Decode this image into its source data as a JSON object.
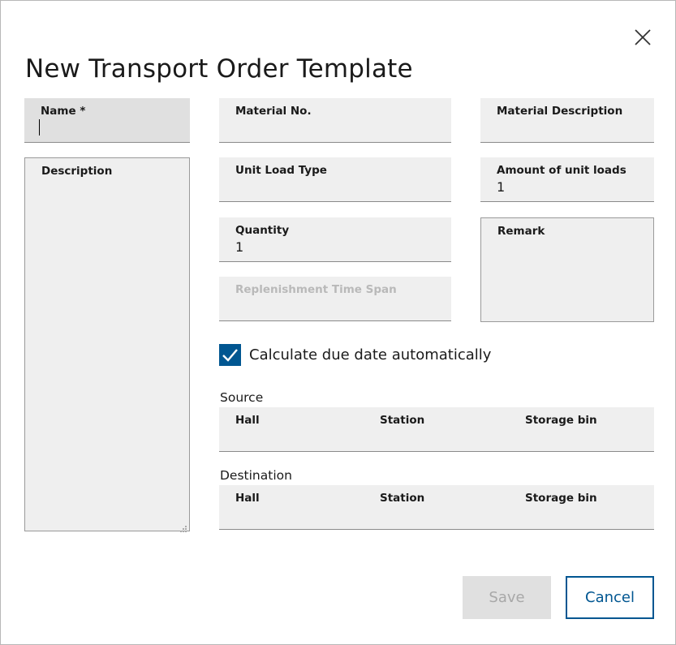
{
  "dialog": {
    "title": "New Transport Order Template",
    "close_icon": "close-icon"
  },
  "fields": {
    "name": {
      "label": "Name *",
      "value": ""
    },
    "description": {
      "label": "Description",
      "value": ""
    },
    "material_no": {
      "label": "Material No.",
      "value": ""
    },
    "material_description": {
      "label": "Material Description",
      "value": ""
    },
    "unit_load_type": {
      "label": "Unit Load Type",
      "value": ""
    },
    "amount_of_unit_loads": {
      "label": "Amount of unit loads",
      "value": "1"
    },
    "quantity": {
      "label": "Quantity",
      "value": "1"
    },
    "remark": {
      "label": "Remark",
      "value": ""
    },
    "replenishment_time_span": {
      "label": "Replenishment Time Span",
      "value": "",
      "disabled": true
    }
  },
  "auto_due_date": {
    "label": "Calculate due date automatically",
    "checked": true
  },
  "source": {
    "label": "Source",
    "columns": [
      "Hall",
      "Station",
      "Storage bin"
    ]
  },
  "destination": {
    "label": "Destination",
    "columns": [
      "Hall",
      "Station",
      "Storage bin"
    ]
  },
  "buttons": {
    "save": "Save",
    "cancel": "Cancel"
  },
  "colors": {
    "accent": "#005691",
    "field_bg": "#efefef",
    "disabled_text": "#b9b9b9"
  }
}
